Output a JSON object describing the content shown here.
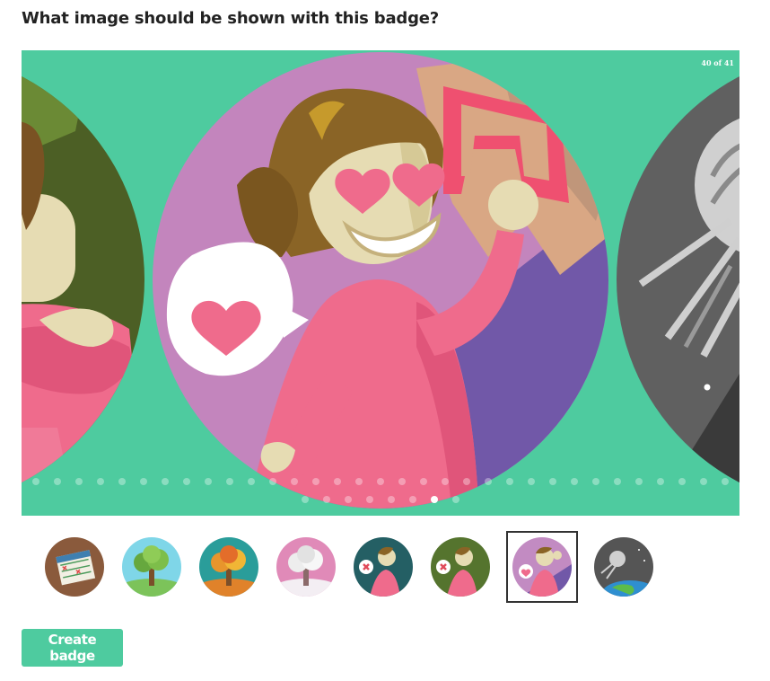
{
  "question": "What image should be shown with this badge?",
  "carousel": {
    "counter": "40 of 41",
    "background_color": "#4ecb9f",
    "slides": [
      {
        "name": "arms-crossed-woman",
        "icon": "woman-arms-crossed-icon"
      },
      {
        "name": "heart-eyes-woman",
        "icon": "woman-heart-eyes-icon"
      },
      {
        "name": "satellite",
        "icon": "satellite-icon"
      }
    ],
    "dots_row1_count": 33,
    "dots_row2_count": 8,
    "active_dot_row2": 6
  },
  "thumbnails": [
    {
      "name": "calendar",
      "icon": "calendar-checklist-icon",
      "bg": "#8a5a3c"
    },
    {
      "name": "tree-spring",
      "icon": "green-tree-icon",
      "bg": "#7fd6e8"
    },
    {
      "name": "tree-autumn",
      "icon": "orange-tree-icon",
      "bg": "#2a9d9a"
    },
    {
      "name": "tree-winter",
      "icon": "snow-tree-icon",
      "bg": "#e08ab8"
    },
    {
      "name": "woman-x-teal",
      "icon": "woman-x-teal-icon",
      "bg": "#245f64"
    },
    {
      "name": "woman-x-green",
      "icon": "woman-x-green-icon",
      "bg": "#55742e"
    },
    {
      "name": "woman-heart",
      "icon": "woman-heart-icon",
      "bg": "#c28bc2",
      "selected": true
    },
    {
      "name": "satellite",
      "icon": "satellite-earth-icon",
      "bg": "#555555"
    }
  ],
  "create_button": "Create badge"
}
